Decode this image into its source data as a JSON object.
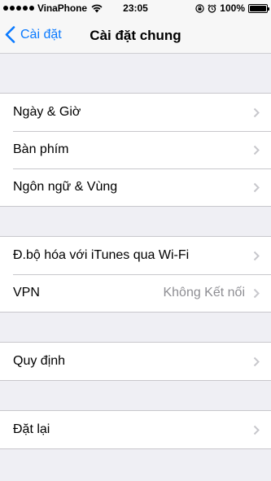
{
  "status_bar": {
    "carrier": "VinaPhone",
    "time": "23:05",
    "battery": "100%"
  },
  "nav": {
    "back_label": "Cài đặt",
    "title": "Cài đặt chung"
  },
  "groups": [
    {
      "items": [
        {
          "label": "Ngày & Giờ"
        },
        {
          "label": "Bàn phím"
        },
        {
          "label": "Ngôn ngữ & Vùng"
        }
      ]
    },
    {
      "items": [
        {
          "label": "Đ.bộ hóa với iTunes qua Wi-Fi"
        },
        {
          "label": "VPN",
          "value": "Không Kết nối"
        }
      ]
    },
    {
      "items": [
        {
          "label": "Quy định"
        }
      ]
    },
    {
      "items": [
        {
          "label": "Đặt lại"
        }
      ]
    }
  ],
  "colors": {
    "accent": "#0a7aff",
    "background": "#efeff4",
    "separator": "#c8c7cc",
    "secondary_text": "#8e8e93"
  }
}
